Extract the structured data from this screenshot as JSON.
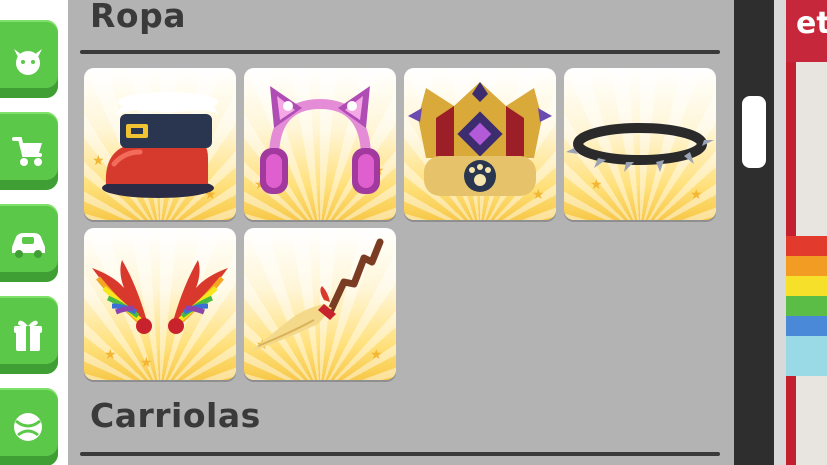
{
  "sidebar": {
    "items": [
      {
        "icon": "cat-face-icon"
      },
      {
        "icon": "stroller-icon"
      },
      {
        "icon": "car-icon"
      },
      {
        "icon": "gift-icon"
      },
      {
        "icon": "ball-icon"
      }
    ]
  },
  "sections": {
    "clothing_title": "Ropa",
    "strollers_title": "Carriolas"
  },
  "items": [
    {
      "name": "santa-boot-hat",
      "icon": "boot-hat-icon"
    },
    {
      "name": "cat-ear-headphones",
      "icon": "cat-ear-headphones-icon"
    },
    {
      "name": "paw-crown",
      "icon": "crown-icon"
    },
    {
      "name": "spiked-collar",
      "icon": "spiked-collar-icon"
    },
    {
      "name": "rainbow-wings",
      "icon": "rainbow-wings-icon"
    },
    {
      "name": "witch-broom",
      "icon": "broom-icon"
    }
  ],
  "background": {
    "banner_text": "et"
  },
  "colors": {
    "panel": "#b3b3b3",
    "button_green": "#5cc84a",
    "title_text": "#3a3a3a",
    "tile_gold": "#f7c94a",
    "banner_red": "#c7273a"
  }
}
